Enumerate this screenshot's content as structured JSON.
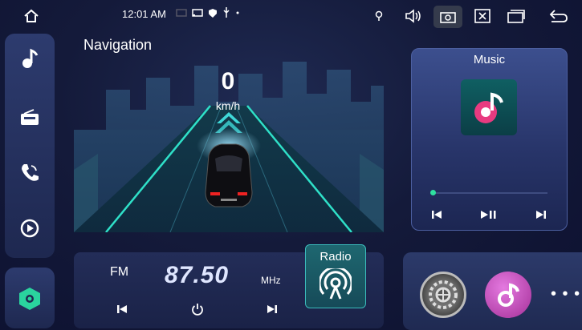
{
  "status_bar": {
    "time": "12:01 AM",
    "icons": [
      "home-icon",
      "screen-icon",
      "cast-icon",
      "shield-icon",
      "usb-icon",
      "dot-icon",
      "location-icon",
      "volume-icon",
      "screenshot-icon",
      "close-window-icon",
      "multi-window-icon",
      "back-icon"
    ]
  },
  "sidebar": {
    "items": [
      "music-note-icon",
      "radio-icon",
      "phone-icon",
      "play-icon"
    ],
    "bottom": "launcher-icon"
  },
  "navigation": {
    "title": "Navigation",
    "speed": "0",
    "speed_unit": "km/h"
  },
  "music": {
    "title": "Music",
    "progress": 0.0,
    "controls": [
      "previous-icon",
      "play-pause-icon",
      "next-icon"
    ]
  },
  "radio": {
    "band": "FM",
    "frequency": "87.50",
    "unit": "MHz",
    "button_label": "Radio",
    "controls": [
      "previous-icon",
      "power-icon",
      "next-icon"
    ]
  },
  "apps": {
    "items": [
      "settings-app",
      "music-app"
    ],
    "more": "• • •"
  },
  "colors": {
    "accent_teal": "#2fe0a0",
    "music_pink": "#e83a80",
    "background": "#141a3a"
  }
}
